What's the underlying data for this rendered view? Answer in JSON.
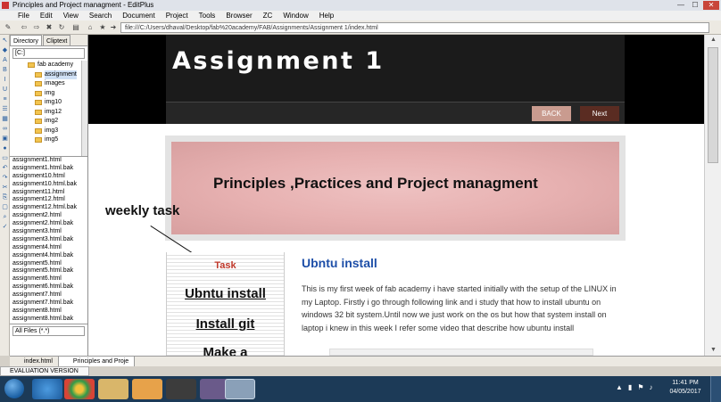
{
  "window": {
    "title": "Principles and Project managment - EditPlus"
  },
  "menu": [
    "File",
    "Edit",
    "View",
    "Search",
    "Document",
    "Project",
    "Tools",
    "Browser",
    "ZC",
    "Window",
    "Help"
  ],
  "address": {
    "url": "file:///C:/Users/dhaval/Desktop/fab%20academy/FAB/Assignments/Assignment 1/index.html"
  },
  "directory_panel": {
    "tabs": [
      "Directory",
      "Cliptext"
    ],
    "drive": "[C:]",
    "tree": [
      {
        "label": "fab academy",
        "selected": false
      },
      {
        "label": "assignment",
        "selected": true
      },
      {
        "label": "images",
        "selected": false
      },
      {
        "label": "img",
        "selected": false
      },
      {
        "label": "img10",
        "selected": false
      },
      {
        "label": "img12",
        "selected": false
      },
      {
        "label": "img2",
        "selected": false
      },
      {
        "label": "img3",
        "selected": false
      },
      {
        "label": "img5",
        "selected": false
      }
    ],
    "files": [
      "assignment1.html",
      "assignment1.html.bak",
      "assignment10.html",
      "assignment10.html.bak",
      "assignment11.html",
      "assignment12.html",
      "assignment12.html.bak",
      "assignment2.html",
      "assignment2.html.bak",
      "assignment3.html",
      "assignment3.html.bak",
      "assignment4.html",
      "assignment4.html.bak",
      "assignment5.html",
      "assignment5.html.bak",
      "assignment6.html",
      "assignment6.html.bak",
      "assignment7.html",
      "assignment7.html.bak",
      "assignment8.html",
      "assignment8.html.bak",
      "assignment9.html"
    ],
    "filter": "All Files (*.*)"
  },
  "doc_tabs": [
    {
      "label": "index.html",
      "active": false
    },
    {
      "label": "Principles and Proje",
      "active": true
    }
  ],
  "page": {
    "header_title": "Assignment 1",
    "back_label": "BACK",
    "next_label": "Next",
    "banner_text": "Principles ,Practices and Project managment",
    "annotation": "weekly task",
    "nav": {
      "task": "Task",
      "ubntu": "Ubntu install",
      "git": "Install git",
      "make": "Make a"
    },
    "section_title": "Ubntu install",
    "paragraph": "This is my first week of fab academy i have started initially with the setup of the LINUX in my Laptop. Firstly i go through following link and i study that how to install ubuntu on windows 32 bit system.Until now we just work on the os but how that system install on laptop i knew in this week I refer some video that describe how ubuntu install"
  },
  "taskbar": {
    "eval": "EVALUATION VERSION",
    "time": "11:41 PM",
    "date": "04/05/2017"
  },
  "colors": {
    "header_bg": "#1b1b1b",
    "back_btn": "#c99b8f",
    "next_btn": "#5a2c22",
    "section_title": "#1e4fa8",
    "task_link": "#c0392b",
    "taskbar": "#1c3a57"
  }
}
